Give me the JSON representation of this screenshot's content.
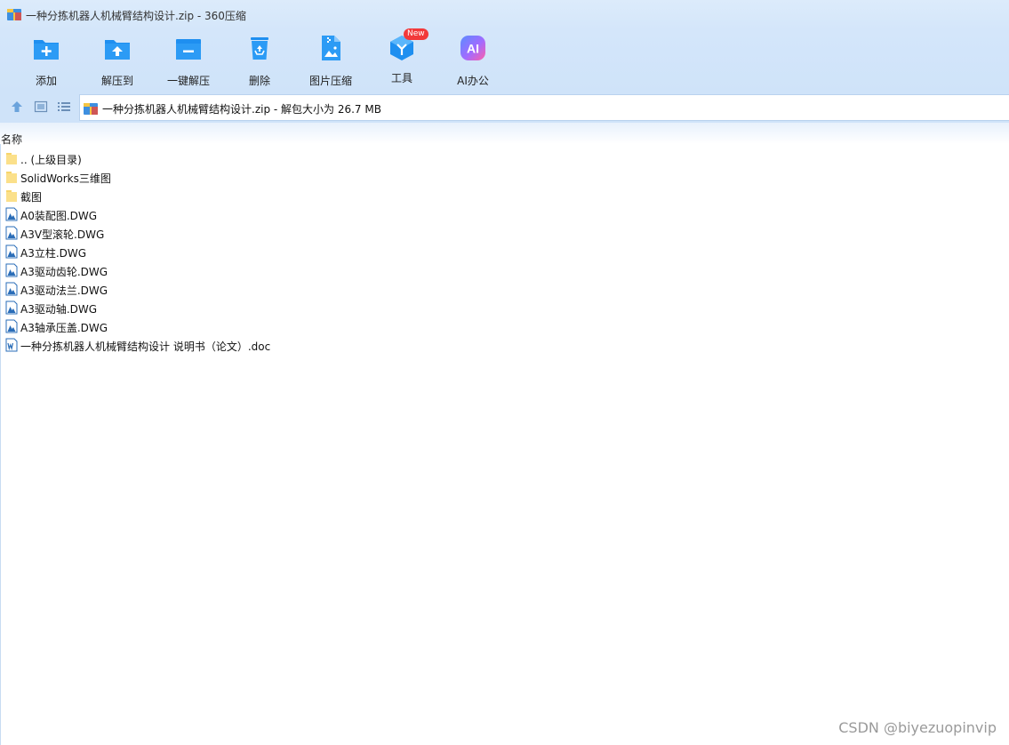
{
  "window": {
    "title": "一种分拣机器人机械臂结构设计.zip - 360压缩"
  },
  "toolbar": {
    "items": [
      {
        "label": "添加",
        "icon": "folder-add-icon"
      },
      {
        "label": "解压到",
        "icon": "folder-extract-icon"
      },
      {
        "label": "一键解压",
        "icon": "folder-one-click-extract-icon"
      },
      {
        "label": "删除",
        "icon": "recycle-bin-icon"
      },
      {
        "label": "图片压缩",
        "icon": "image-compress-icon"
      },
      {
        "label": "工具",
        "icon": "tools-cube-icon",
        "badge": "New"
      },
      {
        "label": "AI办公",
        "icon": "ai-office-icon",
        "icon_text": "AI"
      }
    ]
  },
  "navbar": {
    "path": "一种分拣机器人机械臂结构设计.zip - 解包大小为 26.7 MB"
  },
  "columns": {
    "name": "名称"
  },
  "files": [
    {
      "name": ".. (上级目录)",
      "type": "folder"
    },
    {
      "name": "SolidWorks三维图",
      "type": "folder"
    },
    {
      "name": "截图",
      "type": "folder"
    },
    {
      "name": "A0装配图.DWG",
      "type": "dwg"
    },
    {
      "name": "A3V型滚轮.DWG",
      "type": "dwg"
    },
    {
      "name": "A3立柱.DWG",
      "type": "dwg"
    },
    {
      "name": "A3驱动齿轮.DWG",
      "type": "dwg"
    },
    {
      "name": "A3驱动法兰.DWG",
      "type": "dwg"
    },
    {
      "name": "A3驱动轴.DWG",
      "type": "dwg"
    },
    {
      "name": "A3轴承压盖.DWG",
      "type": "dwg"
    },
    {
      "name": "一种分拣机器人机械臂结构设计 说明书（论文）.doc",
      "type": "doc"
    }
  ],
  "watermark": "CSDN @biyezuopinvip",
  "colors": {
    "toolbar_bg": "#d4e6fa",
    "icon_blue": "#1e8ff0",
    "folder_yellow": "#f7d56b",
    "badge_red": "#f2393a"
  }
}
